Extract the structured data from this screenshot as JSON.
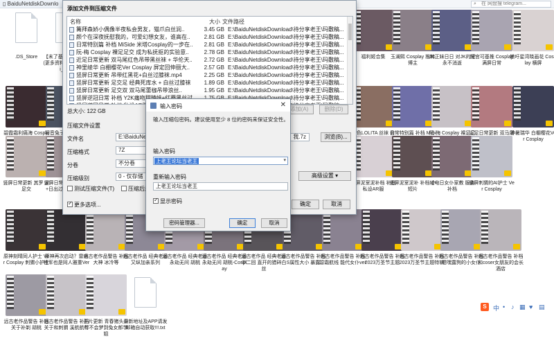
{
  "explorer": {
    "title": "BaiduNetdiskDownlo",
    "search_placeholder": "在 网盘搜 telegram...",
    "tiles": [
      {
        "caption": ".DS_Store",
        "type": "doc",
        "thumb": ""
      },
      {
        "caption": "【末了基地最全资料】(更多资料在电报@sisi_888)",
        "type": "doc",
        "thumb": ""
      },
      {
        "caption": "福利姬合集",
        "type": "video",
        "thumb": "#6b5a63"
      },
      {
        "caption": "玉澜熙 Cosplay 推特博主",
        "type": "video",
        "thumb": "#8a7f88"
      },
      {
        "caption": "JK正妹日日 对JK的爱永不消逝",
        "type": "video",
        "thumb": "#5c5f86"
      },
      {
        "caption": "阿宫可基推 Cosplay 满屏日常",
        "type": "video",
        "thumb": "#a9a4b1"
      },
      {
        "caption": "嫩吁星湾晓画花 Cosplay 横屏",
        "type": "video",
        "thumb": "#d9d2d2"
      },
      {
        "caption": "碧霞霜利痛海 Cosplay 和璃海涂的全合",
        "type": "video",
        "thumb": "#3a2b30"
      },
      {
        "caption": "初音兔子园 Cosplay 酒网黑丝肉好",
        "type": "video",
        "thumb": "#4b5361"
      },
      {
        "caption": "粉色LOLITA 丝袜 会员",
        "type": "video",
        "thumb": "#8a6e62"
      },
      {
        "caption": "日常特别篇 补档 MiSide 米塔",
        "type": "video",
        "thumb": "#6f6fa8"
      },
      {
        "caption": "阮-梅 Cosplay 裸足足交 成为",
        "type": "video",
        "thumb": "#c7c1c6"
      },
      {
        "caption": "近足日常更新 双马尾红色吊带",
        "type": "video",
        "thumb": "#b37a80"
      },
      {
        "caption": "神暑瑞华 白棚樱花Ver Cosplay",
        "type": "video",
        "thumb": "#3c3f55"
      },
      {
        "caption": "竖屏日常更新 其罗 足足交",
        "type": "video",
        "thumb": "#bbb1b0"
      },
      {
        "caption": "竖屏日常更新 双合足 +日出过膝袜 18min",
        "type": "video",
        "thumb": "#9e9296"
      },
      {
        "caption": "竖屏泥室泥补档 补档 私设AR服",
        "type": "video",
        "thumb": "#d8d0d5"
      },
      {
        "caption": "竖屏泥室泥补 补档 小短片",
        "type": "video",
        "thumb": "#5e4f52"
      },
      {
        "caption": "绫电日女仆家教 服务 补档",
        "type": "video",
        "thumb": "#7d6a74"
      },
      {
        "caption": "竖屏刺猬的AI护士 Ver Cosplay",
        "type": "video",
        "thumb": "#bfc0c9"
      },
      {
        "caption": "原神刻晴同人护士 Ver Cosplay 刺猬小护士",
        "type": "video",
        "thumb": "#3a3336"
      },
      {
        "caption": "原神再次启动？雷电将军也是同人雅重Ver",
        "type": "video",
        "thumb": "#332f33"
      },
      {
        "caption": "远古老作品警告 补档 大神 冰冷等",
        "type": "video",
        "thumb": "#b9b3b6"
      },
      {
        "caption": "远古老作品 经典老番 又纵加亲系列",
        "type": "video",
        "thumb": "#8d8896"
      },
      {
        "caption": "远古老作品 经典老番 永劫无间 胡桃",
        "type": "video",
        "thumb": "#a39aa6"
      },
      {
        "caption": "远古老作品 经典老番 永劫无间 胡桃-Cosplay",
        "type": "video",
        "thumb": "#7b737c"
      },
      {
        "caption": "远古老作品 经典老番 中二回 直开的猎碎白丝",
        "type": "video",
        "thumb": "#585459"
      },
      {
        "caption": "远古老作品警告 补档 S属性大小 暴露",
        "type": "video",
        "thumb": "#615c67"
      },
      {
        "caption": "远古老作品警告 补档 碧霜航线 能代女仆ver",
        "type": "video",
        "thumb": "#8a8291"
      },
      {
        "caption": "远古老作品警告 补档 2023万圣节主题",
        "type": "video",
        "thumb": "#4a3f4d"
      },
      {
        "caption": "远古老作品警告 补档 2023万圣节主题特辑",
        "type": "video",
        "thumb": "#cfc8cb"
      },
      {
        "caption": "远古老作品警告 补档 嗯嘿露狗的小女仆",
        "type": "video",
        "thumb": "#a8a6b2"
      },
      {
        "caption": "远古老作品警告 补档 和coser女朋友的会长酒店",
        "type": "video",
        "thumb": "#bab5ba"
      },
      {
        "caption": "远古老作品警告 补档 关于补剃 胡桃",
        "type": "video",
        "thumb": "#9d9aa3"
      },
      {
        "caption": "远古老作品警告 补档 关于和刺猬 溪航航行",
        "type": "video",
        "thumb": "#c7c3c8"
      },
      {
        "caption": "正片更新 青春猪头少年不会梦到兔女郎学姐",
        "type": "video",
        "thumb": "#d8d5db"
      },
      {
        "caption": "最新地址及APP请发邮箱自动获取!!!.txt",
        "type": "doc",
        "thumb": ""
      }
    ]
  },
  "archive": {
    "title": "添加文件到压缩文件",
    "cols": {
      "name": "名称",
      "size": "大小",
      "path": "文件路径"
    },
    "files": [
      {
        "name": "篝拜森娇小偶像半夜私会男友，猫爪白丝润..",
        "size": "3.45 GB",
        "path": "E:\\BaiduNetdiskDownload\\待分享老王\\玛敷稿..."
      },
      {
        "name": "颜个在深夜抚慰我的，可爱幻想女友，谁高在..",
        "size": "2.81 GB",
        "path": "E:\\BaiduNetdiskDownload\\待分享老王\\玛敷稿..."
      },
      {
        "name": "日常特别篇 补档 MiSide 米塔Cosplay的一步在..",
        "size": "2.81 GB",
        "path": "E:\\BaiduNetdiskDownload\\待分享老王\\玛敷稿..."
      },
      {
        "name": "阮-梅 Cosplay 裸足足交 成为私抚抠的实验意..",
        "size": "2.78 GB",
        "path": "E:\\BaiduNetdiskDownload\\待分享老王\\玛敷稿..."
      },
      {
        "name": "近足日常更新 双马尾红色吊带黑丝袜 + 华伦天..",
        "size": "2.72 GB",
        "path": "E:\\BaiduNetdiskDownload\\待分享老王\\玛敷稿..."
      },
      {
        "name": "神里绫华 白棚樱花Ver Cosplay 屏定回伸丽大..",
        "size": "2.57 GB",
        "path": "E:\\BaiduNetdiskDownload\\待分享老王\\玛敷稿..."
      },
      {
        "name": "竖屏日常更新 吊带红黑花+白丝过膝袜.mp4",
        "size": "2.25 GB",
        "path": "E:\\BaiduNetdiskDownload\\待分享老王\\玛敷稿..."
      },
      {
        "name": "竖屏日常更新 足交足 经典死库水 + 白丝过膝袜",
        "size": "1.89 GB",
        "path": "E:\\BaiduNetdiskDownload\\待分享老王\\玛敷稿..."
      },
      {
        "name": "竖屏日常更新 足交双 双马尾蕾枷吊带浪丝..",
        "size": "1.95 GB",
        "path": "E:\\BaiduNetdiskDownload\\待分享老王\\玛敷稿..."
      },
      {
        "name": "竖屏逆冠日常 补档 Y2K痛吻甜辣妹+红蘑黑丝过..",
        "size": "1.75 GB",
        "path": "E:\\BaiduNetdiskDownload\\待分享老王\\玛敷稿..."
      },
      {
        "name": "竖屏逆冠日常 补档 私设AR服萌萌长短腿女..",
        "size": "1.37 GB",
        "path": "E:\\BaiduNetdiskDownload\\待分享老王\\玛敷稿..."
      }
    ],
    "total": "总大小: 122 GB",
    "add_label": "添加(A)",
    "delete_label": "删除(D)",
    "settings_title": "压缩文件设置",
    "filename_label": "文件名",
    "filename_value": "E:\\BaiduNetdiskDownload\\",
    "filename_tail": "我.7z",
    "browse_label": "浏览(B)...",
    "format_label": "压缩格式",
    "format_value": "7Z",
    "split_label": "分卷",
    "split_value": "不分卷",
    "level_label": "压缩级别",
    "level_value": "0 - 仅存储",
    "advanced_label": "高级设置",
    "test_label": "测试压缩文件(T)",
    "delete_after_label": "压缩后删",
    "more_label": "更多选项...",
    "ok_label": "确定",
    "cancel_label": "取消"
  },
  "password": {
    "title": "输入密码",
    "hint": "输入压缩包密码。建议使用至少 8 位的密码来保证安全性。",
    "pw1_label": "输入密码",
    "pw1_value": "上老王论坛当老王",
    "pw2_label": "重新输入密码",
    "pw2_value": "上老王论坛当老王",
    "show_label": "显示密码",
    "manager_label": "密码管理器...",
    "ok_label": "确定",
    "cancel_label": "取消"
  }
}
